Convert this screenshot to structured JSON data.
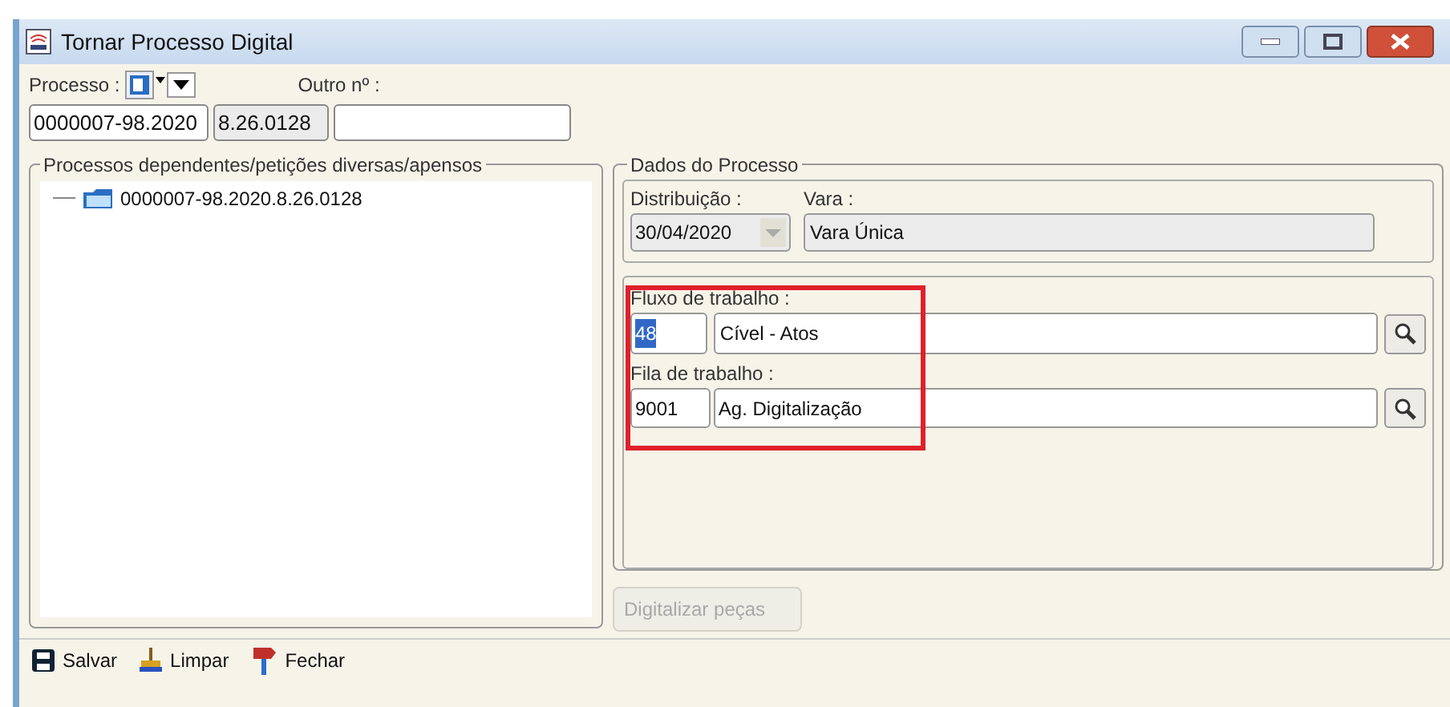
{
  "window": {
    "title": "Tornar Processo Digital"
  },
  "processo": {
    "label": "Processo :",
    "number": "0000007-98.2020",
    "origin": "8.26.0128",
    "outro_label": "Outro nº :"
  },
  "dependentes": {
    "title": "Processos dependentes/petições diversas/apensos",
    "items": [
      {
        "label": "0000007-98.2020.8.26.0128"
      }
    ]
  },
  "dados": {
    "title": "Dados do Processo",
    "distribuicao_label": "Distribuição :",
    "distribuicao": "30/04/2020",
    "vara_label": "Vara :",
    "vara": "Vara Única",
    "fluxo_label": "Fluxo de trabalho :",
    "fluxo_code": "48",
    "fluxo_code_selected": true,
    "fluxo": "Cível - Atos",
    "fila_label": "Fila de trabalho :",
    "fila_code": "9001",
    "fila": "Ag. Digitalização"
  },
  "digitalizar": {
    "label": "Digitalizar peças",
    "disabled": true
  },
  "toolbar": [
    {
      "kind": "save",
      "label": "Salvar"
    },
    {
      "kind": "clear",
      "label": "Limpar"
    },
    {
      "kind": "close",
      "label": "Fechar"
    }
  ]
}
